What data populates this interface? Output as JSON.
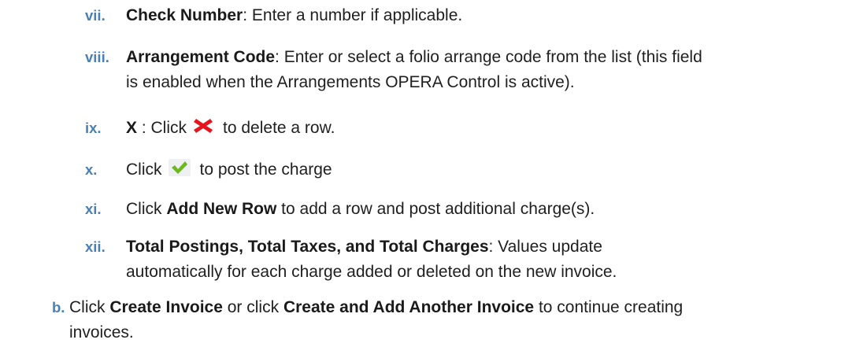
{
  "steps": [
    {
      "num": "vii.",
      "label": "Check Number",
      "rest": ": Enter a number if applicable."
    },
    {
      "num": "viii.",
      "label": "Arrangement Code",
      "rest_line1": ": Enter or select a folio arrange code from the list (this field",
      "rest_line2": "is enabled when the Arrangements OPERA Control is active)."
    },
    {
      "num": "ix.",
      "label": "X",
      "pre": " : Click",
      "post": "to delete a row.",
      "icon": "delete-x-icon"
    },
    {
      "num": "x.",
      "pre": "Click",
      "post": "to post the charge",
      "icon": "checkmark-icon"
    },
    {
      "num": "xi.",
      "pre": "Click ",
      "label": "Add New Row",
      "post": " to add a row and post additional charge(s)."
    },
    {
      "num": "xii.",
      "label": "Total Postings, Total Taxes, and Total Charges",
      "rest_line1": ": Values update",
      "rest_line2": "automatically for each charge added or deleted on the new invoice."
    },
    {
      "num": "b.",
      "pre": "Click ",
      "label1": "Create Invoice",
      "mid": " or click ",
      "label2": "Create and Add Another Invoice",
      "post_line1": " to continue creating",
      "post_line2": "invoices."
    }
  ],
  "colors": {
    "numeral": "#4a7fb5",
    "text": "#1a1a1a",
    "delete_icon": "#e8141c",
    "check_icon": "#6cb91f"
  }
}
